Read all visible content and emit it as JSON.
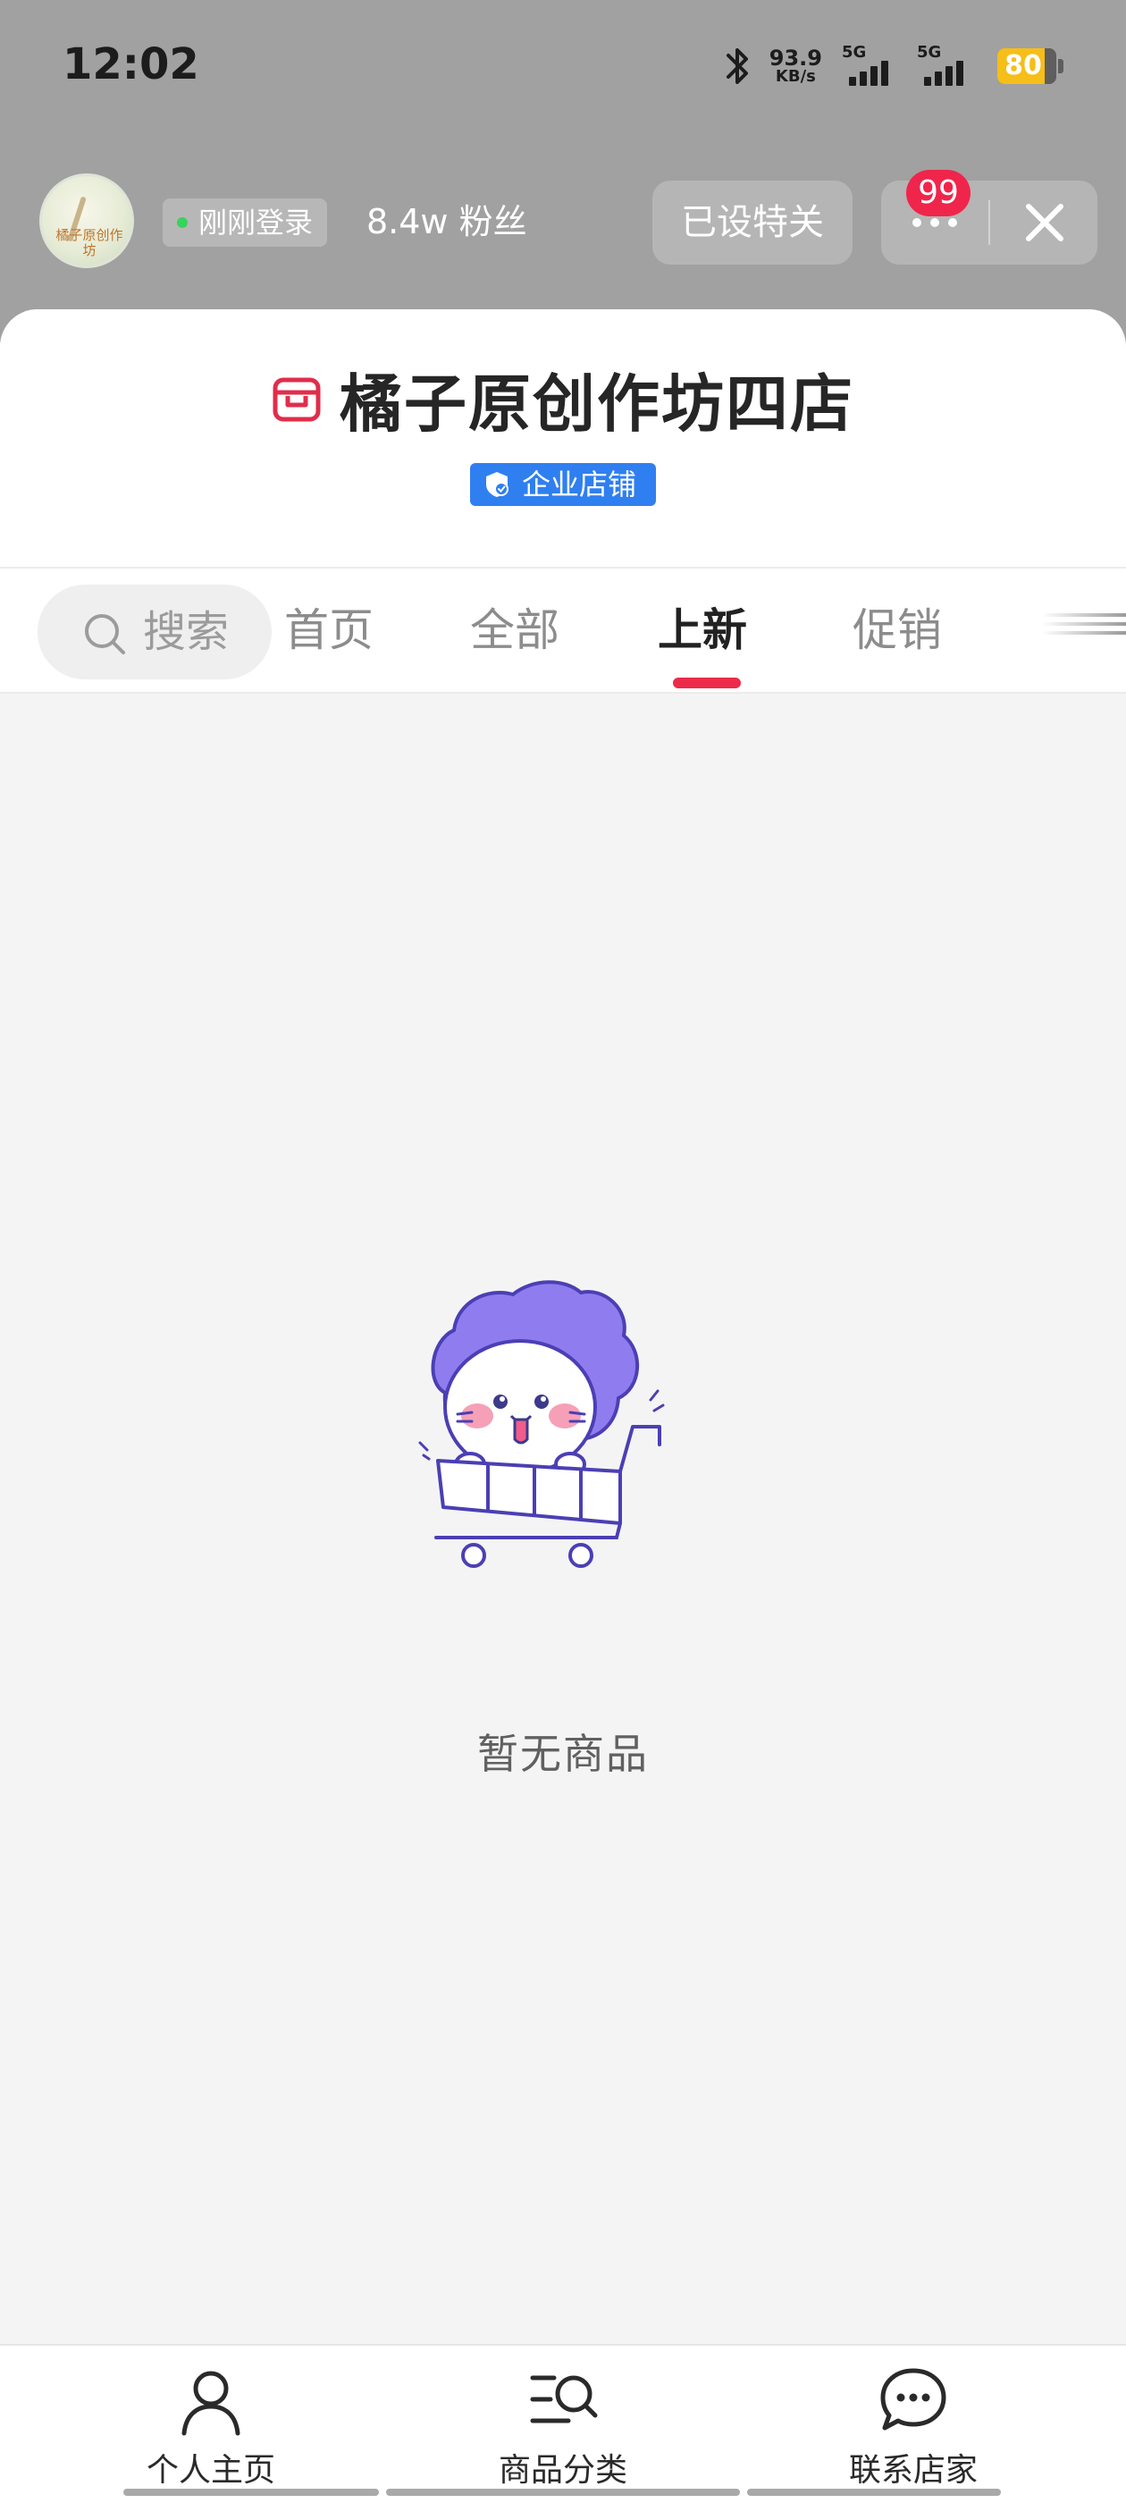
{
  "status_bar": {
    "time": "12:02",
    "net_speed_value": "93.9",
    "net_speed_unit": "KB/s",
    "sim1_tag": "5G",
    "sim2_tag": "5G",
    "battery_level": "80",
    "battery_fraction": 0.8,
    "icons": [
      "bluetooth-icon",
      "signal-icon",
      "battery-icon"
    ]
  },
  "header": {
    "avatar_text": "橘子原创作坊",
    "online_status": "刚刚登录",
    "fans": "8.4w 粉丝",
    "follow_label": "已设特关",
    "badge_count": "99",
    "more_icon": "more-dots-icon",
    "close_icon": "close-icon"
  },
  "shop": {
    "name": "橘子原创作坊四店",
    "store_icon": "store-icon",
    "verified_label": "企业店铺",
    "brand_color": "#ec2a49",
    "verified_color": "#2f7ff0"
  },
  "tabs": {
    "search_label": "搜索",
    "items": [
      {
        "label": "首页",
        "active": false
      },
      {
        "label": "全部",
        "active": false
      },
      {
        "label": "上新",
        "active": true
      },
      {
        "label": "促销",
        "active": false
      }
    ]
  },
  "empty_state": {
    "illustration": "shopping-cart-mascot",
    "message": "暂无商品"
  },
  "bottom_nav": {
    "items": [
      {
        "label": "个人主页",
        "icon": "person-icon"
      },
      {
        "label": "商品分类",
        "icon": "category-search-icon"
      },
      {
        "label": "联系店家",
        "icon": "chat-bubble-icon"
      }
    ]
  }
}
